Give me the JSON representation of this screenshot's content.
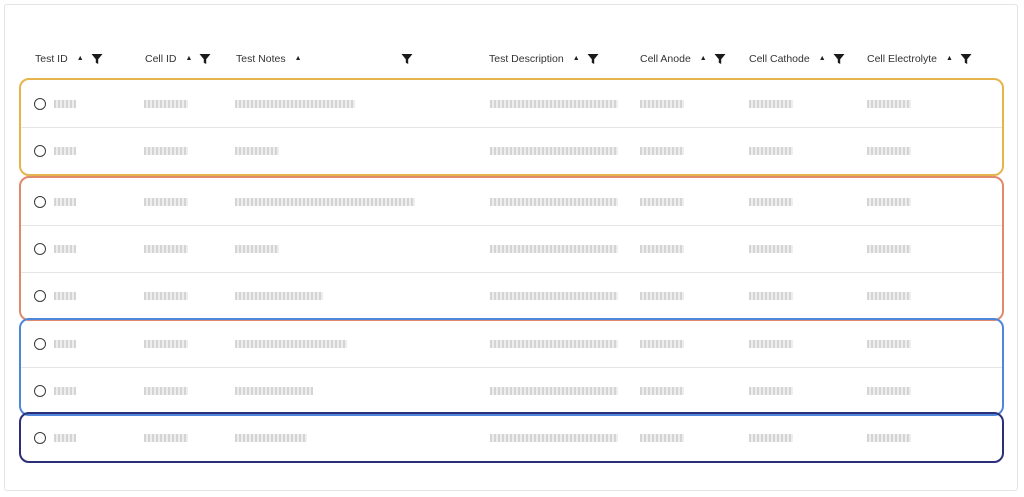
{
  "columns": [
    {
      "label": "Test ID"
    },
    {
      "label": "Cell ID"
    },
    {
      "label": "Test Notes"
    },
    {
      "label": "Test Description"
    },
    {
      "label": "Cell Anode"
    },
    {
      "label": "Cell Cathode"
    },
    {
      "label": "Cell Electrolyte"
    }
  ],
  "icons": {
    "sort": "sort-ascending-icon",
    "filter": "filter-icon",
    "select": "radio-button"
  },
  "groups": [
    {
      "color": "#e6b44c",
      "rows": 2
    },
    {
      "color": "#e0896b",
      "rows": 3
    },
    {
      "color": "#4f86d9",
      "rows": 2
    },
    {
      "color": "#2b2f7a",
      "rows": 1
    }
  ],
  "notes_redacted_length": [
    120,
    44,
    180,
    44,
    88,
    112,
    78,
    72
  ]
}
